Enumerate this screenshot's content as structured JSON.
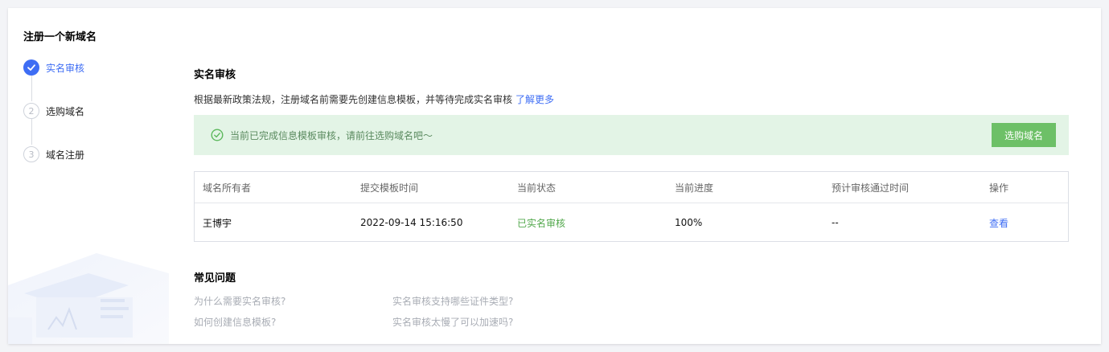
{
  "page_title": "注册一个新域名",
  "steps": [
    {
      "index": "✓",
      "label": "实名审核",
      "state": "done"
    },
    {
      "index": "2",
      "label": "选购域名",
      "state": "todo"
    },
    {
      "index": "3",
      "label": "域名注册",
      "state": "todo"
    }
  ],
  "realname": {
    "title": "实名审核",
    "description": "根据最新政策法规，注册域名前需要先创建信息模板，并等待完成实名审核",
    "learn_more": "了解更多"
  },
  "notice": {
    "text": "当前已完成信息模板审核，请前往选购域名吧～",
    "button": "选购域名"
  },
  "table": {
    "headers": [
      "域名所有者",
      "提交模板时间",
      "当前状态",
      "当前进度",
      "预计审核通过时间",
      "操作"
    ],
    "row": {
      "owner": "王博宇",
      "submit_time": "2022-09-14 15:16:50",
      "status": "已实名审核",
      "progress": "100%",
      "eta": "--",
      "action": "查看"
    }
  },
  "faq": {
    "title": "常见问题",
    "items": [
      "为什么需要实名审核?",
      "实名审核支持哪些证件类型?",
      "如何创建信息模板?",
      "实名审核太慢了可以加速吗?"
    ]
  },
  "colors": {
    "accent": "#3e6df4",
    "success_bg": "#e3f4e6",
    "success_btn": "#6dc067",
    "success_text": "#52a84c"
  }
}
